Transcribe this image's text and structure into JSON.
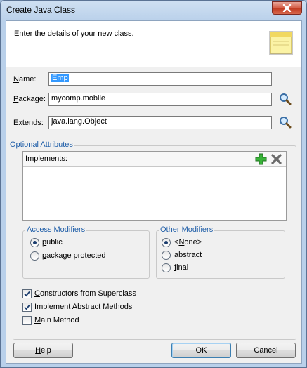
{
  "window": {
    "title": "Create Java Class"
  },
  "header": {
    "description": "Enter the details of your new class."
  },
  "form": {
    "name": {
      "label_key": "N",
      "label_rest": "ame:",
      "value": "Emp"
    },
    "package": {
      "label_key": "P",
      "label_rest": "ackage:",
      "value": "mycomp.mobile"
    },
    "extends": {
      "label_key": "E",
      "label_rest": "xtends:",
      "value": "java.lang.Object"
    }
  },
  "optional": {
    "title": "Optional Attributes",
    "implements_label_key": "I",
    "implements_label_rest": "mplements:",
    "implements_items": []
  },
  "access": {
    "title": "Access Modifiers",
    "options": [
      {
        "key": "p",
        "rest": "ublic",
        "selected": true
      },
      {
        "key": "p",
        "rest": "ackage protected",
        "selected": false
      }
    ]
  },
  "other": {
    "title": "Other Modifiers",
    "options": [
      {
        "key": "N",
        "pre": "<",
        "rest": "one>",
        "selected": true
      },
      {
        "key": "a",
        "pre": "",
        "rest": "bstract",
        "selected": false
      },
      {
        "key": "f",
        "pre": "",
        "rest": "inal",
        "selected": false
      }
    ]
  },
  "checks": [
    {
      "key": "C",
      "rest": "onstructors from Superclass",
      "checked": true
    },
    {
      "key": "I",
      "rest": "mplement Abstract Methods",
      "checked": true
    },
    {
      "key": "M",
      "rest": "ain Method",
      "checked": false
    }
  ],
  "buttons": {
    "help_key": "H",
    "help_rest": "elp",
    "ok": "OK",
    "cancel": "Cancel"
  },
  "icons": {
    "close": "close-icon",
    "header": "note-icon",
    "browse": "magnifier-icon",
    "add": "add-icon",
    "remove": "remove-icon"
  },
  "colors": {
    "group_title": "#1f5ea8",
    "selection": "#3399ff",
    "add_green": "#2e9d2e"
  }
}
